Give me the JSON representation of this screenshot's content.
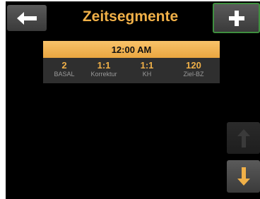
{
  "header": {
    "title": "Zeitsegmente"
  },
  "segment": {
    "time": "12:00 AM",
    "values": [
      {
        "value": "2",
        "label": "BASAL"
      },
      {
        "value": "1:1",
        "label": "Korrektur"
      },
      {
        "value": "1:1",
        "label": "KH"
      },
      {
        "value": "120",
        "label": "Ziel-BZ"
      }
    ]
  },
  "buttons": {
    "back_icon": "arrow-left-icon",
    "add_icon": "plus-icon",
    "up_icon": "arrow-up-icon",
    "down_icon": "arrow-down-icon"
  },
  "colors": {
    "accent": "#f0b048",
    "header_bar": "#f2b458",
    "add_border": "#3f8f3f",
    "background": "#000000"
  }
}
